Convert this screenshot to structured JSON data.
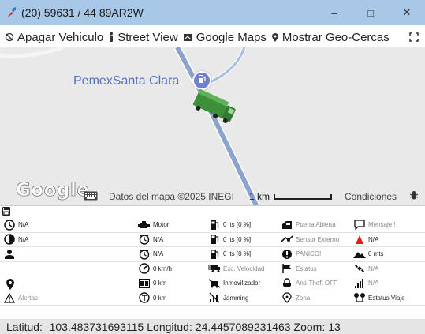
{
  "window": {
    "title": "(20) 59631 / 44 89AR2W",
    "minimize": "–",
    "maximize": "□",
    "close": "✕"
  },
  "toolbar": {
    "apagar": "Apagar Vehiculo",
    "street_view": "Street View",
    "google_maps": "Google Maps",
    "geocercas": "Mostrar Geo-Cercas"
  },
  "map": {
    "place_label": "PemexSanta Clara",
    "google_logo": "Google",
    "attribution": "Datos del mapa ©2025 INEGI",
    "scale": "1 km",
    "terms": "Condiciones"
  },
  "grid": {
    "rows": [
      {
        "c1": {
          "icon": "clock-icon",
          "text": "N/A"
        },
        "c2": {
          "icon": "engine-icon",
          "text": "Motor"
        },
        "c3": {
          "icon": "fuel-icon",
          "text": "0 lts [0 %]"
        },
        "c4": {
          "icon": "door-icon",
          "text": "Puerta Abierta",
          "grey": true
        },
        "c5": {
          "icon": "message-icon",
          "text": "Mensaje!!",
          "grey": true
        }
      },
      {
        "c1": {
          "icon": "half-clock-icon",
          "text": "N/A"
        },
        "c2": {
          "icon": "timer-icon",
          "text": "N/A"
        },
        "c3": {
          "icon": "fuel-icon",
          "text": "0 lts [0 %]"
        },
        "c4": {
          "icon": "sensor-icon",
          "text": "Sensor Externo",
          "grey": true
        },
        "c5": {
          "icon": "warning-red-icon",
          "text": "N/A"
        }
      },
      {
        "c1": {
          "icon": "driver-icon",
          "text": ""
        },
        "c2": {
          "icon": "timer-icon",
          "text": "N/A"
        },
        "c3": {
          "icon": "fuel-icon",
          "text": "0 lts [0 %]"
        },
        "c4": {
          "icon": "alert-icon",
          "text": "PANICO!",
          "grey": true
        },
        "c5": {
          "icon": "mountain-icon",
          "text": "0 mts"
        }
      },
      {
        "c1": {
          "icon": "",
          "text": ""
        },
        "c2": {
          "icon": "speedometer-icon",
          "text": "0 km/h"
        },
        "c3": {
          "icon": "speeding-truck-icon",
          "text": "Exc. Velocidad",
          "grey": true
        },
        "c4": {
          "icon": "flag-icon",
          "text": "Estatus",
          "grey": true
        },
        "c5": {
          "icon": "satellite-icon",
          "text": "N/A",
          "grey": true
        }
      },
      {
        "c1": {
          "icon": "",
          "text": ""
        },
        "c2": {
          "icon": "odometer-icon",
          "text": "0 km"
        },
        "c3": {
          "icon": "immobilizer-icon",
          "text": "Inmovilizador"
        },
        "c4": {
          "icon": "lock-icon",
          "text": "Anti-Theft OFF",
          "grey": true
        },
        "c5": {
          "icon": "signal-icon",
          "text": "N/A",
          "grey": true
        }
      },
      {
        "c1": {
          "icon": "triangle-alert-icon",
          "text": "Alertas",
          "grey": true
        },
        "c2": {
          "icon": "trip-icon",
          "text": "0 km"
        },
        "c3": {
          "icon": "jamming-icon",
          "text": "Jamming"
        },
        "c4": {
          "icon": "zone-icon",
          "text": "Zona",
          "grey": true
        },
        "c5": {
          "icon": "trip-status-icon",
          "text": "Estatus Viaje"
        }
      }
    ]
  },
  "status": {
    "lat_label": "Latitud:",
    "lat_value": "-103.483731693115",
    "lon_label": "Longitud:",
    "lon_value": "24.4457089231463",
    "zoom_label": "Zoom:",
    "zoom_value": "13"
  }
}
